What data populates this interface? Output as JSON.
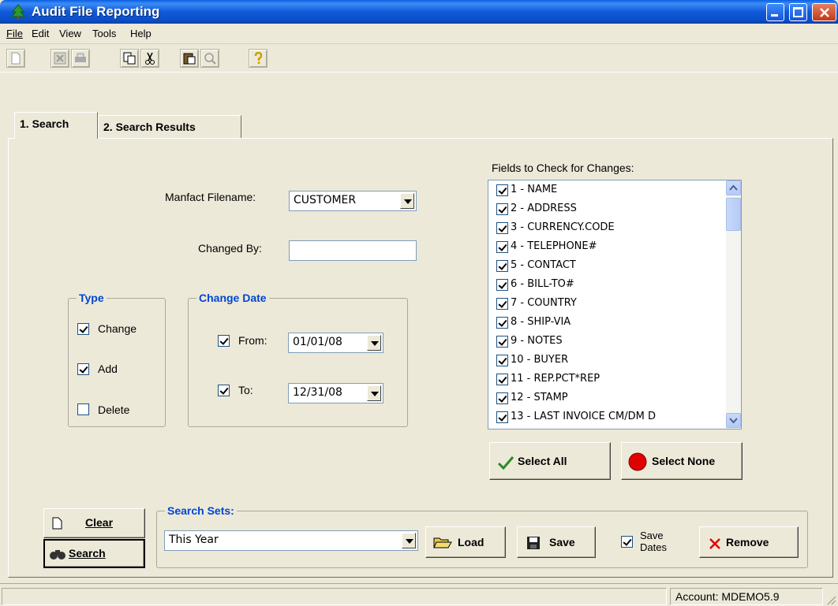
{
  "window": {
    "title": "Audit File Reporting"
  },
  "menu": [
    "File",
    "Edit",
    "View",
    "Tools",
    "Help"
  ],
  "tabs": [
    {
      "label": "1. Search",
      "active": true
    },
    {
      "label": "2. Search Results",
      "active": false
    }
  ],
  "form": {
    "manfact_label": "Manfact Filename:",
    "manfact_value": "CUSTOMER",
    "changed_by_label": "Changed By:",
    "changed_by_value": ""
  },
  "type_group": {
    "title": "Type",
    "change": {
      "label": "Change",
      "checked": true
    },
    "add": {
      "label": "Add",
      "checked": true
    },
    "delete": {
      "label": "Delete",
      "checked": false
    }
  },
  "change_date": {
    "title": "Change Date",
    "from": {
      "label": "From:",
      "checked": true,
      "value": "01/01/08"
    },
    "to": {
      "label": "To:",
      "checked": true,
      "value": "12/31/08"
    }
  },
  "fields": {
    "title": "Fields to Check for Changes:",
    "items": [
      "1 - NAME",
      "2 - ADDRESS",
      "3 - CURRENCY.CODE",
      "4 - TELEPHONE#",
      "5 - CONTACT",
      "6 - BILL-TO#",
      "7 - COUNTRY",
      "8 - SHIP-VIA",
      "9 - NOTES",
      "10 - BUYER",
      "11 - REP.PCT*REP",
      "12 - STAMP",
      "13 - LAST INVOICE CM/DM D"
    ],
    "select_all": "Select All",
    "select_none": "Select None"
  },
  "actions": {
    "clear": "Clear",
    "search": "Search"
  },
  "search_sets": {
    "title": "Search Sets:",
    "value": "This Year",
    "load": "Load",
    "save": "Save",
    "save_dates": "Save Dates",
    "save_dates_checked": true,
    "remove": "Remove"
  },
  "status": {
    "account": "Account: MDEMO5.9"
  },
  "colors": {
    "titlebar": "#0a5fe0",
    "group_title": "#0046d5",
    "face": "#ece9d8"
  }
}
